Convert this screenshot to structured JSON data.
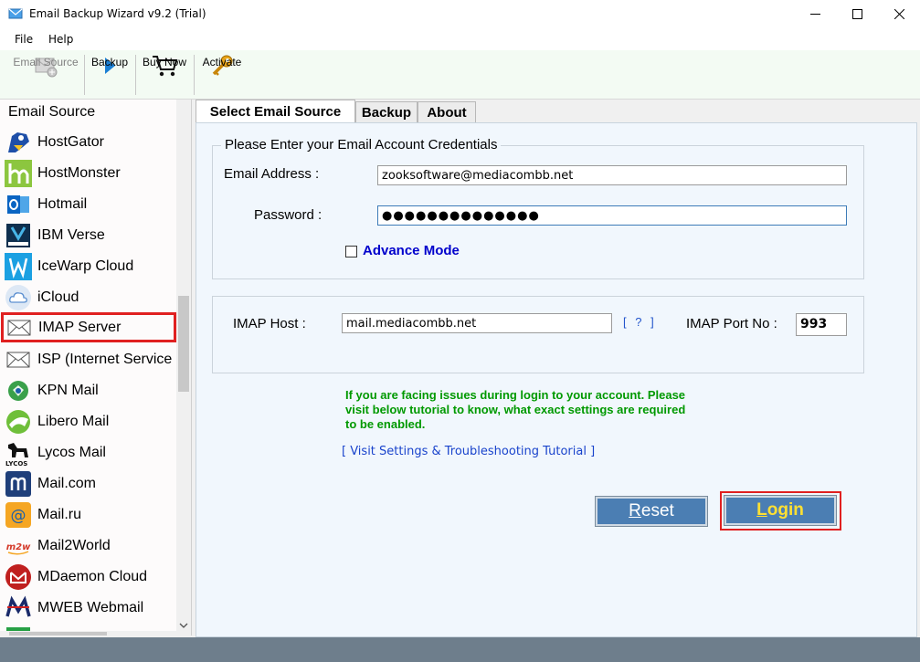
{
  "window": {
    "title": "Email Backup Wizard v9.2 (Trial)",
    "controls": [
      "minimize-icon",
      "maximize-icon",
      "close-icon"
    ]
  },
  "menu": {
    "items": [
      "File",
      "Help"
    ]
  },
  "toolbar": {
    "email_source": "Email Source",
    "backup": "Backup",
    "buy_now": "Buy Now",
    "activate": "Activate"
  },
  "sidebar": {
    "header": "Email Source",
    "selected": "IMAP Server",
    "items": [
      {
        "label": "HostGator",
        "icon": "hostgator-icon"
      },
      {
        "label": "HostMonster",
        "icon": "hostmonster-icon"
      },
      {
        "label": "Hotmail",
        "icon": "outlook-icon"
      },
      {
        "label": "IBM Verse",
        "icon": "ibm-verse-icon"
      },
      {
        "label": "IceWarp Cloud",
        "icon": "icewarp-icon"
      },
      {
        "label": "iCloud",
        "icon": "icloud-icon"
      },
      {
        "label": "IMAP Server",
        "icon": "envelope-icon"
      },
      {
        "label": "ISP (Internet Service",
        "icon": "envelope-icon"
      },
      {
        "label": "KPN Mail",
        "icon": "kpn-icon"
      },
      {
        "label": "Libero Mail",
        "icon": "libero-icon"
      },
      {
        "label": "Lycos Mail",
        "icon": "lycos-icon"
      },
      {
        "label": "Mail.com",
        "icon": "mailcom-icon"
      },
      {
        "label": "Mail.ru",
        "icon": "mailru-icon"
      },
      {
        "label": "Mail2World",
        "icon": "mail2world-icon"
      },
      {
        "label": "MDaemon Cloud",
        "icon": "mdaemon-icon"
      },
      {
        "label": "MWEB Webmail",
        "icon": "mweb-icon"
      }
    ]
  },
  "tabs": [
    {
      "label": "Select Email Source",
      "active": true
    },
    {
      "label": "Backup",
      "active": false
    },
    {
      "label": "About",
      "active": false
    }
  ],
  "credentials": {
    "group_title": "Please Enter your Email Account Credentials",
    "email_label": "Email Address :",
    "email_value": "zooksoftware@mediacombb.net",
    "password_label": "Password :",
    "password_value": "●●●●●●●●●●●●●●",
    "advance_mode": "Advance Mode",
    "advance_mode_checked": false
  },
  "imap": {
    "host_label": "IMAP Host :",
    "host_value": "mail.mediacombb.net",
    "help_link": "[ ? ]",
    "port_label": "IMAP Port No :",
    "port_value": "993"
  },
  "notice": {
    "line1": "If you are facing issues during login to your account. Please",
    "line2": "visit below tutorial to know, what exact settings are required",
    "line3": "to be enabled.",
    "tutorial_link": "[ Visit Settings & Troubleshooting Tutorial ]"
  },
  "actions": {
    "reset": "Reset",
    "login": "Login"
  },
  "colors": {
    "button_bg": "#4b7eb3",
    "login_text": "#ffe033",
    "highlight_red": "#e02020",
    "notice_green": "#009900",
    "statusbar": "#6e7e8c"
  }
}
